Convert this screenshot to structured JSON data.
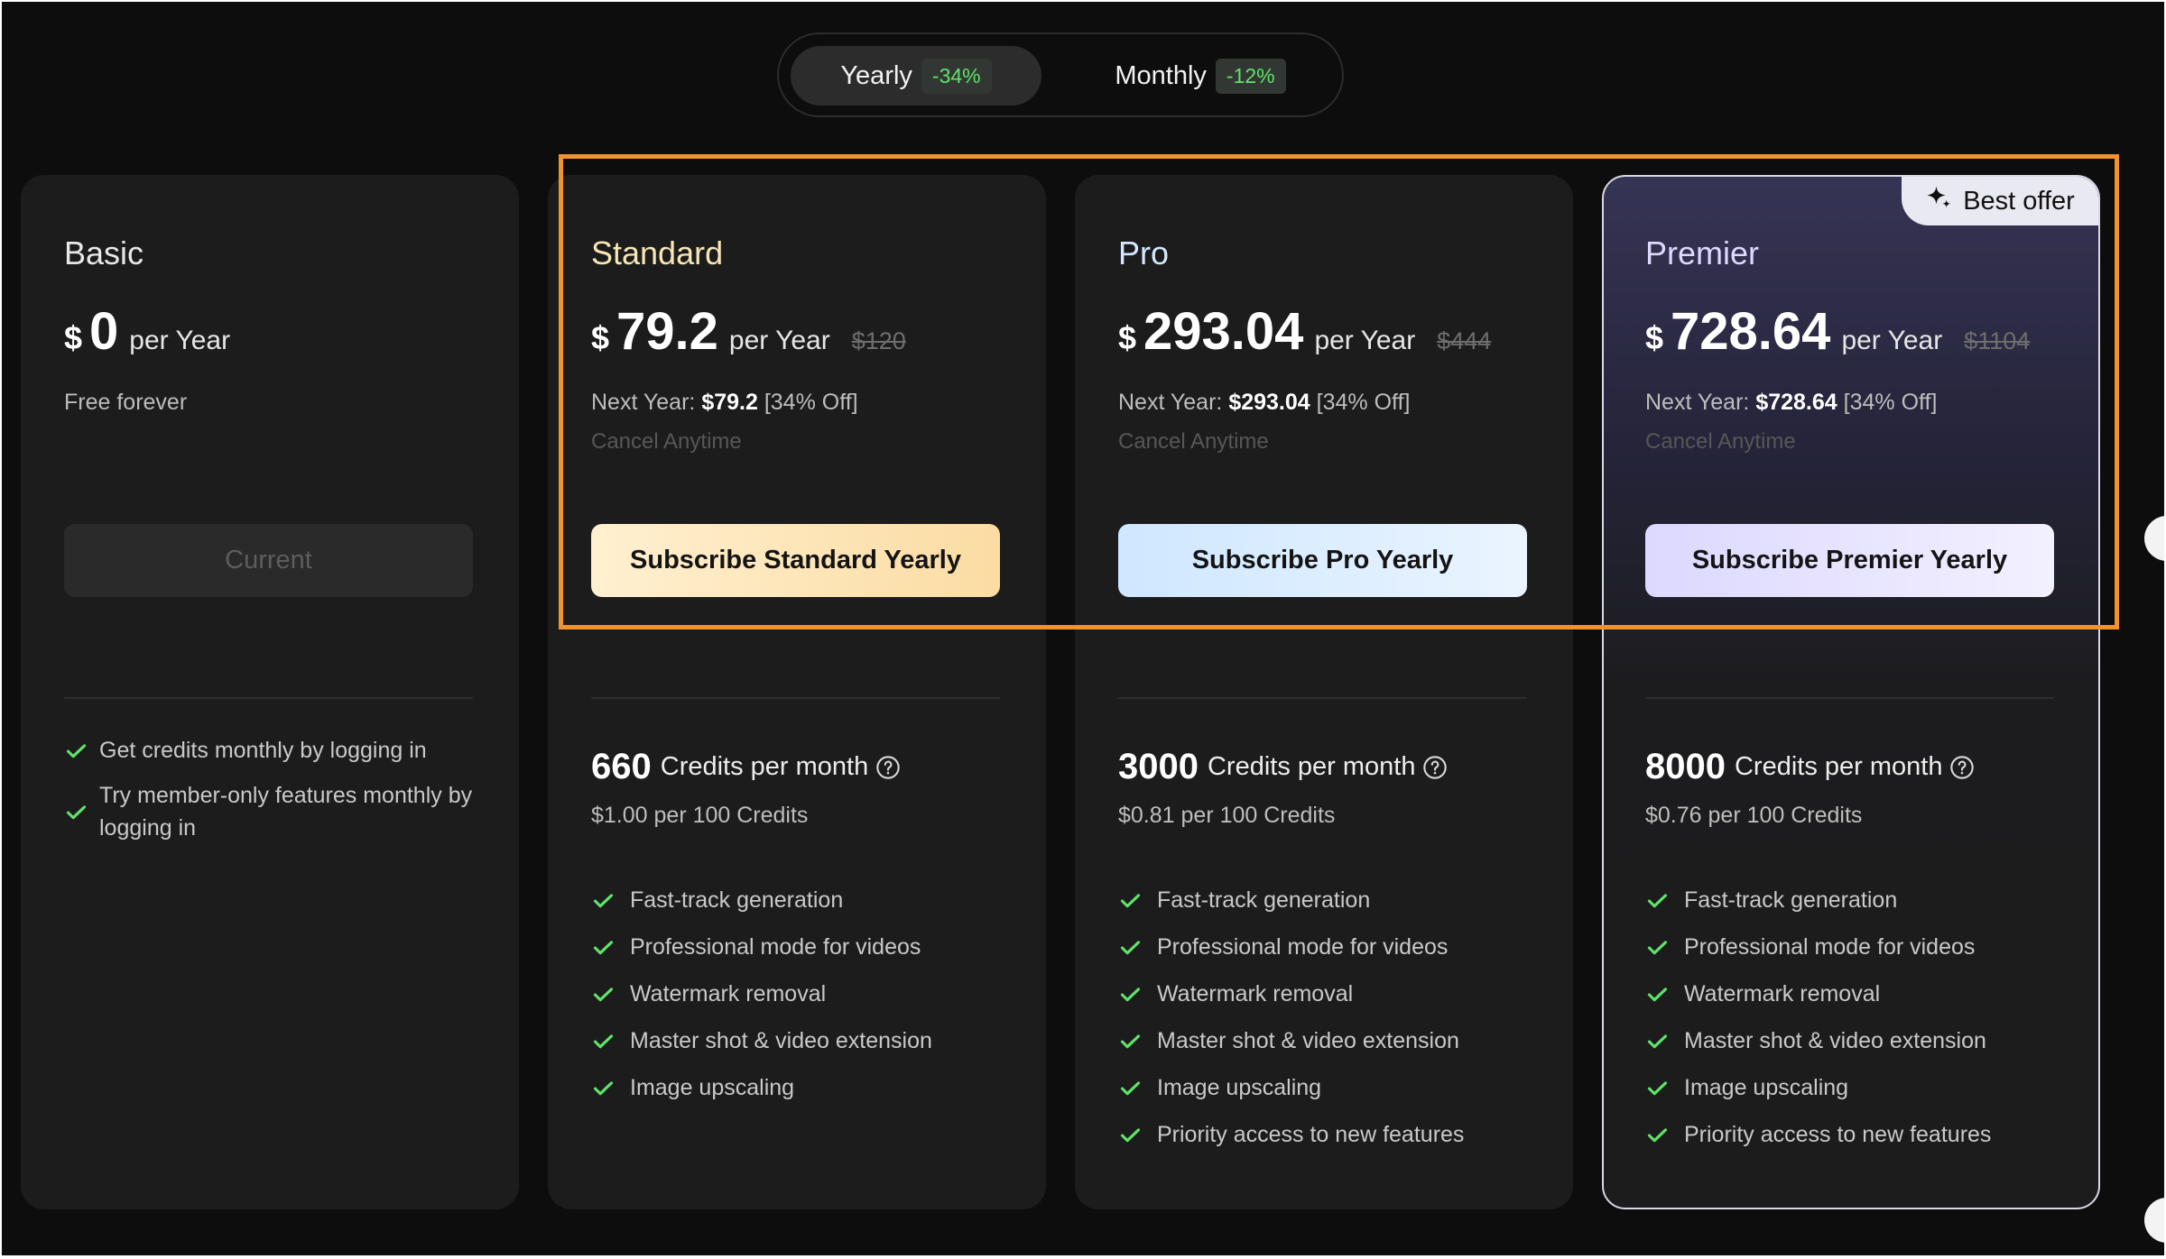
{
  "toggle": {
    "yearly_label": "Yearly",
    "yearly_discount": "-34%",
    "monthly_label": "Monthly",
    "monthly_discount": "-12%"
  },
  "colors": {
    "highlight": "#f0922e",
    "check": "#5fe36b",
    "background": "#0d0d0d",
    "card": "#1c1c1c"
  },
  "plans": [
    {
      "name": "Basic",
      "currency": "$",
      "price": "0",
      "period": "per Year",
      "subtitle": "Free forever",
      "button": "Current",
      "features": [
        "Get credits monthly by logging in",
        "Try member-only features monthly by logging in"
      ]
    },
    {
      "name": "Standard",
      "currency": "$",
      "price": "79.2",
      "period": "per Year",
      "original_price": "$120",
      "next_year_label": "Next Year:",
      "next_year_price": "$79.2",
      "next_year_discount": "[34% Off]",
      "cancel": "Cancel Anytime",
      "button": "Subscribe Standard Yearly",
      "credits": "660",
      "credits_label": "Credits per month",
      "per_100": "$1.00 per 100 Credits",
      "features": [
        "Fast-track generation",
        "Professional mode for videos",
        "Watermark removal",
        "Master shot & video extension",
        "Image upscaling"
      ]
    },
    {
      "name": "Pro",
      "currency": "$",
      "price": "293.04",
      "period": "per Year",
      "original_price": "$444",
      "next_year_label": "Next Year:",
      "next_year_price": "$293.04",
      "next_year_discount": "[34% Off]",
      "cancel": "Cancel Anytime",
      "button": "Subscribe Pro Yearly",
      "credits": "3000",
      "credits_label": "Credits per month",
      "per_100": "$0.81 per 100 Credits",
      "features": [
        "Fast-track generation",
        "Professional mode for videos",
        "Watermark removal",
        "Master shot & video extension",
        "Image upscaling",
        "Priority access to new features"
      ]
    },
    {
      "name": "Premier",
      "badge": "Best offer",
      "currency": "$",
      "price": "728.64",
      "period": "per Year",
      "original_price": "$1104",
      "next_year_label": "Next Year:",
      "next_year_price": "$728.64",
      "next_year_discount": "[34% Off]",
      "cancel": "Cancel Anytime",
      "button": "Subscribe Premier Yearly",
      "credits": "8000",
      "credits_label": "Credits per month",
      "per_100": "$0.76 per 100 Credits",
      "features": [
        "Fast-track generation",
        "Professional mode for videos",
        "Watermark removal",
        "Master shot & video extension",
        "Image upscaling",
        "Priority access to new features"
      ]
    }
  ]
}
